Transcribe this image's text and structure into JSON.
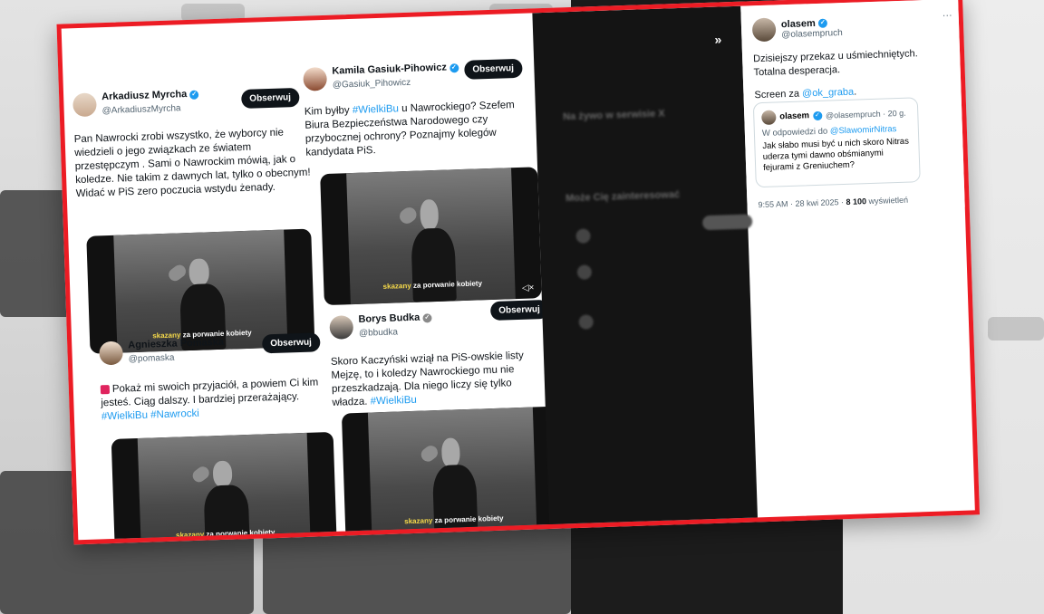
{
  "left_col": {
    "author": "Arkadiusz Myrcha",
    "handle": "@ArkadiuszMyrcha",
    "follow": "Obserwuj",
    "text": "Pan Nawrocki zrobi wszystko, że wyborcy nie wiedzieli o jego związkach ze światem przestępczym . Sami o Nawrockim mówią, jak o koledze. Nie takim z dawnych lat, tylko o obecnym!\nWidać w PiS zero poczucia wstydu żenady.",
    "video_subtitle_a": "skazany",
    "video_subtitle_b": "za porwanie kobiety"
  },
  "left_col2": {
    "author": "Agnieszka Pomaska",
    "handle": "@pomaska",
    "follow": "Obserwuj",
    "text": "Pokaż mi swoich przyjaciół, a powiem Ci kim jesteś. Ciąg dalszy. I bardziej przerażający.",
    "tags": "#WielkiBu #Nawrocki",
    "video_subtitle_a": "skazany",
    "video_subtitle_b": "za porwanie kobiety"
  },
  "mid_col": {
    "author": "Kamila Gasiuk-Pihowicz",
    "handle": "@Gasiuk_Pihowicz",
    "follow": "Obserwuj",
    "text_a": "Kim byłby ",
    "tag": "#WielkiBu",
    "text_b": " u Nawrockiego? Szefem Biura Bezpieczeństwa Narodowego czy przybocznej ochrony? Poznajmy kolegów kandydata PiS.",
    "video_subtitle_a": "skazany",
    "video_subtitle_b": "za porwanie kobiety"
  },
  "mid_col2": {
    "author": "Borys Budka",
    "handle": "@bbudka",
    "follow": "Obserwuj",
    "text": "Skoro Kaczyński wziął na PiS-owskie listy Mejzę, to i koledzy Nawrockiego mu nie przeszkadzają. Dla niego liczy się tylko władza. ",
    "tag": "#WielkiBu",
    "video_subtitle_a": "skazany",
    "video_subtitle_b": "za porwanie kobiety"
  },
  "dark_panel": {
    "blur1": "Na żywo w serwisie X",
    "blur2": "Może Cię zainteresować"
  },
  "right_post": {
    "author": "olasem",
    "handle": "@olasempruch",
    "text1": "Dzisiejszy przekaz u uśmiechniętych. Totalna desperacja.",
    "screen_label": "Screen za ",
    "screen_tag": "@ok_graba",
    "screen_end": ".",
    "quote_author": "olasem",
    "quote_handle": "@olasempruch · 20 g.",
    "quote_reply": "W odpowiedzi do ",
    "quote_reply_tag": "@SlawomirNitras",
    "quote_text": "Jak słabo musi być u nich skoro Nitras uderza tymi dawno obśmianymi fejurami z Greniuchem?",
    "timestamp": "9:55 AM · 28 kwi 2025 · ",
    "views": "8 100",
    "views_label": " wyświetleń"
  }
}
